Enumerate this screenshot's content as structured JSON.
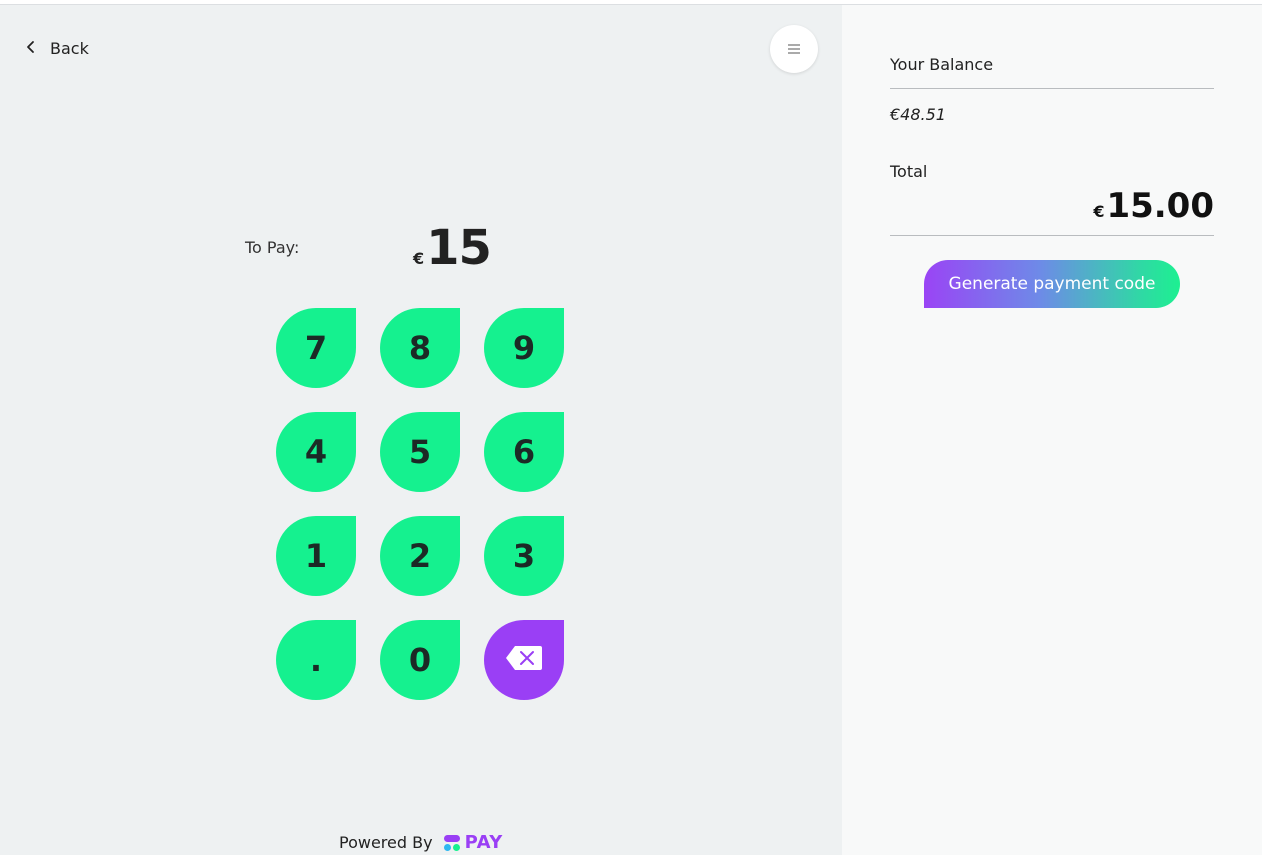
{
  "nav": {
    "back_label": "Back"
  },
  "menu": {
    "icon": "hamburger-icon"
  },
  "payment": {
    "to_pay_label": "To Pay:",
    "currency_symbol": "€",
    "amount": "15"
  },
  "keypad": {
    "keys": [
      "7",
      "8",
      "9",
      "4",
      "5",
      "6",
      "1",
      "2",
      "3",
      ".",
      "0"
    ],
    "backspace_icon": "backspace-icon",
    "key_color": "#15f18f",
    "backspace_color": "#9a3ff5"
  },
  "footer": {
    "powered_by_label": "Powered By",
    "brand_name": "PAY"
  },
  "summary": {
    "balance_label": "Your Balance",
    "balance_value": "€48.51",
    "total_label": "Total",
    "total_currency": "€",
    "total_value": "15.00"
  },
  "actions": {
    "generate_label": "Generate payment code"
  },
  "colors": {
    "accent_purple": "#9a3ff5",
    "accent_green": "#15f18f"
  }
}
